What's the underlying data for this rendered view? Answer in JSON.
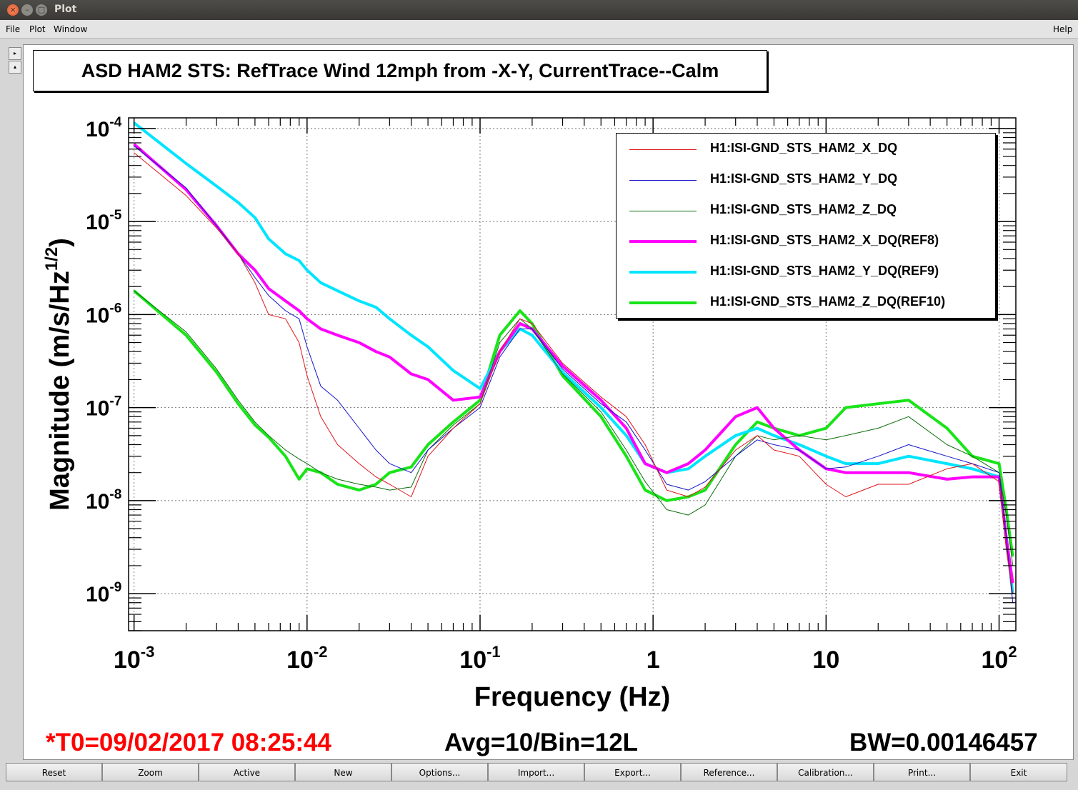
{
  "window": {
    "title": "Plot"
  },
  "menu": {
    "file": "File",
    "plot": "Plot",
    "window": "Window",
    "help": "Help"
  },
  "side": {
    "right_arrow": "▸",
    "up_arrow": "▴"
  },
  "plot": {
    "title": "ASD HAM2 STS: RefTrace Wind 12mph from -X-Y, CurrentTrace--Calm",
    "status": {
      "t0": "*T0=09/02/2017 08:25:44",
      "avg": "Avg=10/Bin=12L",
      "bw": "BW=0.00146457"
    },
    "colors": {
      "t0": "#ff0000"
    }
  },
  "chart_data": {
    "type": "line",
    "xlabel": "Frequency (Hz)",
    "ylabel": "Magnitude (m/s/Hz^1/2)",
    "xscale": "log",
    "yscale": "log",
    "xlim": [
      0.00093,
      125
    ],
    "ylim": [
      4e-10,
      0.00013
    ],
    "grid": true,
    "legend": "top-right",
    "xticks": [
      {
        "v": 0.001,
        "base": "10",
        "exp": "-3"
      },
      {
        "v": 0.01,
        "base": "10",
        "exp": "-2"
      },
      {
        "v": 0.1,
        "base": "10",
        "exp": "-1"
      },
      {
        "v": 1,
        "base": "1",
        "exp": ""
      },
      {
        "v": 10,
        "base": "10",
        "exp": ""
      },
      {
        "v": 100,
        "base": "10",
        "exp": "2"
      }
    ],
    "yticks": [
      {
        "v": 0.0001,
        "base": "10",
        "exp": "-4"
      },
      {
        "v": 1e-05,
        "base": "10",
        "exp": "-5"
      },
      {
        "v": 1e-06,
        "base": "10",
        "exp": "-6"
      },
      {
        "v": 1e-07,
        "base": "10",
        "exp": "-7"
      },
      {
        "v": 1e-08,
        "base": "10",
        "exp": "-8"
      },
      {
        "v": 1e-09,
        "base": "10",
        "exp": "-9"
      }
    ],
    "series": [
      {
        "name": "H1:ISI-GND_STS_HAM2_X_DQ",
        "color": "#e0161c",
        "width": 1,
        "x": [
          0.001,
          0.002,
          0.003,
          0.004,
          0.005,
          0.006,
          0.0075,
          0.009,
          0.01,
          0.012,
          0.015,
          0.02,
          0.025,
          0.03,
          0.04,
          0.05,
          0.07,
          0.1,
          0.13,
          0.17,
          0.2,
          0.3,
          0.5,
          0.7,
          0.9,
          1.2,
          1.6,
          2,
          3,
          4,
          5,
          7,
          10,
          13,
          20,
          30,
          50,
          70,
          100,
          110,
          120
        ],
        "y": [
          5.5e-05,
          1.9e-05,
          8.5e-06,
          4.5e-06,
          2.2e-06,
          1e-06,
          9e-07,
          5e-07,
          2.2e-07,
          8e-08,
          4e-08,
          2.5e-08,
          1.8e-08,
          1.5e-08,
          1.1e-08,
          3e-08,
          6e-08,
          1.1e-07,
          4e-07,
          9e-07,
          8e-07,
          3e-07,
          1.3e-07,
          8e-08,
          4e-08,
          1.3e-08,
          1.1e-08,
          1.4e-08,
          3.5e-08,
          5e-08,
          3.5e-08,
          3e-08,
          1.5e-08,
          1.1e-08,
          1.5e-08,
          1.5e-08,
          2.2e-08,
          2.5e-08,
          1.6e-08,
          3e-09,
          1e-09
        ]
      },
      {
        "name": "H1:ISI-GND_STS_HAM2_Y_DQ",
        "color": "#1414c8",
        "width": 1,
        "x": [
          0.001,
          0.002,
          0.003,
          0.004,
          0.005,
          0.006,
          0.0075,
          0.009,
          0.01,
          0.012,
          0.015,
          0.02,
          0.025,
          0.03,
          0.04,
          0.05,
          0.07,
          0.1,
          0.13,
          0.17,
          0.2,
          0.3,
          0.5,
          0.7,
          0.9,
          1.2,
          1.6,
          2,
          3,
          4,
          5,
          7,
          10,
          13,
          20,
          30,
          50,
          70,
          100,
          110,
          120
        ],
        "y": [
          6.5e-05,
          2.3e-05,
          9e-06,
          4.5e-06,
          2.5e-06,
          1.6e-06,
          1.1e-06,
          9e-07,
          4.5e-07,
          1.7e-07,
          1.2e-07,
          6e-08,
          3.5e-08,
          2.5e-08,
          2e-08,
          3.5e-08,
          6e-08,
          1e-07,
          3.5e-07,
          7e-07,
          7e-07,
          2.6e-07,
          1.1e-07,
          7e-08,
          3.5e-08,
          1.5e-08,
          1.3e-08,
          1.6e-08,
          3e-08,
          4.5e-08,
          4e-08,
          3.5e-08,
          2.2e-08,
          2.3e-08,
          3e-08,
          4e-08,
          3e-08,
          2.5e-08,
          2e-08,
          4e-09,
          8e-10
        ]
      },
      {
        "name": "H1:ISI-GND_STS_HAM2_Z_DQ",
        "color": "#0a6e0a",
        "width": 1,
        "x": [
          0.001,
          0.002,
          0.003,
          0.004,
          0.005,
          0.006,
          0.0075,
          0.009,
          0.01,
          0.012,
          0.015,
          0.02,
          0.025,
          0.03,
          0.04,
          0.05,
          0.07,
          0.1,
          0.13,
          0.17,
          0.2,
          0.3,
          0.5,
          0.7,
          0.9,
          1.2,
          1.6,
          2,
          3,
          4,
          5,
          7,
          10,
          13,
          20,
          30,
          50,
          70,
          100,
          110,
          120
        ],
        "y": [
          1.8e-06,
          6.5e-07,
          2.6e-07,
          1.2e-07,
          7e-08,
          5e-08,
          3.5e-08,
          2.8e-08,
          2.5e-08,
          2e-08,
          1.7e-08,
          1.5e-08,
          1.4e-08,
          1.3e-08,
          1.4e-08,
          3.5e-08,
          6.5e-08,
          1.1e-07,
          5e-07,
          9e-07,
          7e-07,
          2.3e-07,
          9e-08,
          3.5e-08,
          1.6e-08,
          8e-09,
          7e-09,
          9e-09,
          3e-08,
          5e-08,
          4.5e-08,
          5e-08,
          4.5e-08,
          5e-08,
          6e-08,
          8e-08,
          4e-08,
          3e-08,
          2e-08,
          7e-09,
          2e-09
        ]
      },
      {
        "name": "H1:ISI-GND_STS_HAM2_X_DQ(REF8)",
        "color": "#ff00ff",
        "width": 4,
        "x": [
          0.001,
          0.002,
          0.003,
          0.004,
          0.005,
          0.006,
          0.0075,
          0.009,
          0.01,
          0.012,
          0.015,
          0.02,
          0.025,
          0.03,
          0.04,
          0.05,
          0.07,
          0.1,
          0.13,
          0.17,
          0.2,
          0.3,
          0.5,
          0.7,
          0.9,
          1.2,
          1.6,
          2,
          3,
          4,
          5,
          7,
          10,
          13,
          20,
          30,
          50,
          70,
          100,
          110,
          120
        ],
        "y": [
          6.8e-05,
          2.2e-05,
          9e-06,
          4.5e-06,
          3e-06,
          1.9e-06,
          1.4e-06,
          1.1e-06,
          9e-07,
          7e-07,
          6e-07,
          5e-07,
          4e-07,
          3.5e-07,
          2.3e-07,
          2e-07,
          1.2e-07,
          1.3e-07,
          4e-07,
          8e-07,
          7e-07,
          2.8e-07,
          1.2e-07,
          6e-08,
          2.5e-08,
          2e-08,
          2.5e-08,
          3.5e-08,
          8e-08,
          1e-07,
          6e-08,
          3.5e-08,
          2.2e-08,
          2e-08,
          2e-08,
          2e-08,
          1.7e-08,
          1.8e-08,
          1.8e-08,
          4e-09,
          1.3e-09
        ]
      },
      {
        "name": "H1:ISI-GND_STS_HAM2_Y_DQ(REF9)",
        "color": "#00e5ff",
        "width": 4,
        "x": [
          0.001,
          0.002,
          0.003,
          0.004,
          0.005,
          0.006,
          0.0075,
          0.009,
          0.01,
          0.012,
          0.015,
          0.02,
          0.025,
          0.03,
          0.04,
          0.05,
          0.07,
          0.1,
          0.13,
          0.17,
          0.2,
          0.3,
          0.5,
          0.7,
          0.9,
          1.2,
          1.6,
          2,
          3,
          4,
          5,
          7,
          10,
          13,
          20,
          30,
          50,
          70,
          100,
          110,
          120
        ],
        "y": [
          0.000115,
          4.2e-05,
          2.4e-05,
          1.6e-05,
          1.1e-05,
          6.5e-06,
          4.5e-06,
          3.8e-06,
          3e-06,
          2.2e-06,
          1.8e-06,
          1.4e-06,
          1.2e-06,
          9e-07,
          6e-07,
          4.5e-07,
          2.5e-07,
          1.6e-07,
          4e-07,
          7e-07,
          6e-07,
          2.4e-07,
          1e-07,
          5e-08,
          2.5e-08,
          2e-08,
          2.2e-08,
          3e-08,
          5e-08,
          6e-08,
          5e-08,
          4e-08,
          3e-08,
          2.5e-08,
          2.5e-08,
          3e-08,
          2.5e-08,
          2.2e-08,
          1.8e-08,
          4e-09,
          1e-09
        ]
      },
      {
        "name": "H1:ISI-GND_STS_HAM2_Z_DQ(REF10)",
        "color": "#18e418",
        "width": 4,
        "x": [
          0.001,
          0.002,
          0.003,
          0.004,
          0.005,
          0.006,
          0.0075,
          0.009,
          0.01,
          0.012,
          0.015,
          0.02,
          0.025,
          0.03,
          0.04,
          0.05,
          0.07,
          0.1,
          0.13,
          0.17,
          0.2,
          0.3,
          0.5,
          0.7,
          0.9,
          1.2,
          1.6,
          2,
          3,
          4,
          5,
          7,
          10,
          13,
          20,
          30,
          50,
          70,
          100,
          110,
          120
        ],
        "y": [
          1.8e-06,
          6e-07,
          2.4e-07,
          1.1e-07,
          6.5e-08,
          4.8e-08,
          3e-08,
          1.7e-08,
          2.2e-08,
          2e-08,
          1.5e-08,
          1.3e-08,
          1.5e-08,
          2e-08,
          2.3e-08,
          4e-08,
          7e-08,
          1.2e-07,
          6e-07,
          1.1e-06,
          8e-07,
          2.2e-07,
          8e-08,
          3e-08,
          1.3e-08,
          1e-08,
          1.1e-08,
          1.3e-08,
          4e-08,
          7e-08,
          6e-08,
          5e-08,
          6e-08,
          1e-07,
          1.1e-07,
          1.2e-07,
          6e-08,
          3e-08,
          2.5e-08,
          8e-09,
          2.5e-09
        ]
      }
    ]
  },
  "toolbar": {
    "reset": "Reset",
    "zoom": "Zoom",
    "active": "Active",
    "new": "New",
    "options": "Options...",
    "import": "Import...",
    "export": "Export...",
    "reference": "Reference...",
    "calibration": "Calibration...",
    "print": "Print...",
    "exit": "Exit"
  }
}
